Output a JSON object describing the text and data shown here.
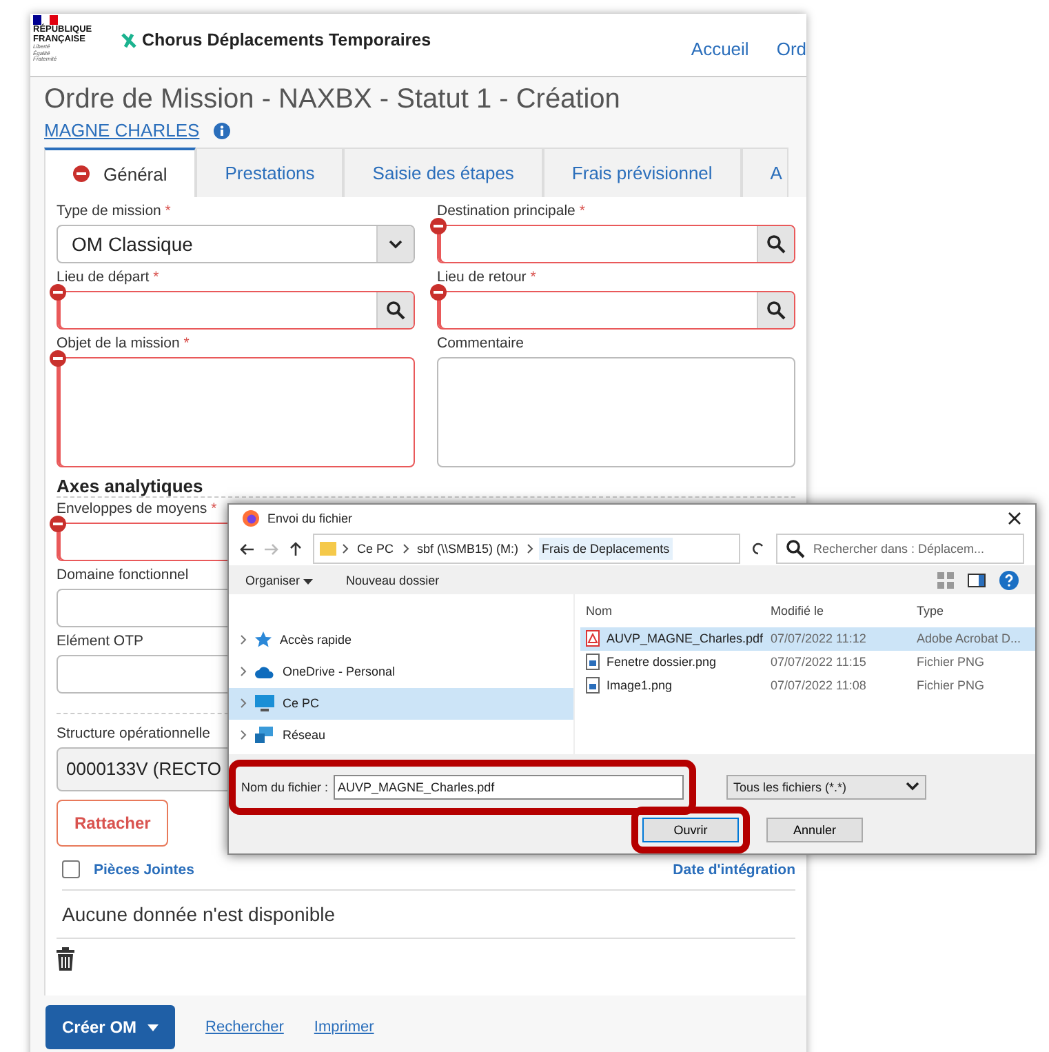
{
  "header": {
    "logo_lines": [
      "RÉPUBLIQUE",
      "FRANÇAISE"
    ],
    "motto": [
      "Liberté",
      "Égalité",
      "Fraternité"
    ],
    "app_name": "Chorus Déplacements Temporaires",
    "nav": [
      "Accueil",
      "Ord"
    ]
  },
  "page": {
    "title": "Ordre de Mission - NAXBX - Statut 1 - Création",
    "traveler": "MAGNE CHARLES"
  },
  "tabs": [
    {
      "label": "Général",
      "selected": true,
      "error": true
    },
    {
      "label": "Prestations",
      "selected": false,
      "error": false
    },
    {
      "label": "Saisie des étapes",
      "selected": false,
      "error": false
    },
    {
      "label": "Frais prévisionnel",
      "selected": false,
      "error": false
    },
    {
      "label": "A",
      "selected": false,
      "error": false
    }
  ],
  "form": {
    "fields": [
      {
        "label": "Type de mission",
        "required_mark": "*",
        "error": false,
        "kind": "select",
        "value": "OM Classique"
      },
      {
        "label": "Destination principale",
        "required_mark": "*",
        "error": true,
        "kind": "search"
      },
      {
        "label": "Lieu de départ",
        "required_mark": "*",
        "error": true,
        "kind": "search"
      },
      {
        "label": "Lieu de retour",
        "required_mark": "*",
        "error": true,
        "kind": "search"
      },
      {
        "label": "Objet de la mission",
        "required_mark": "*",
        "error": true,
        "kind": "textarea"
      },
      {
        "label": "Commentaire",
        "error": false,
        "kind": "textarea"
      }
    ]
  },
  "axes": {
    "heading": "Axes analytiques",
    "fields": [
      {
        "label": "Enveloppes de moyens",
        "required_mark": "*",
        "error": true,
        "kind": "text"
      },
      {
        "label": "Domaine fonctionnel",
        "error": false,
        "kind": "text"
      },
      {
        "label": "Elément OTP",
        "error": false,
        "kind": "text"
      }
    ]
  },
  "structure": {
    "label": "Structure opérationnelle",
    "value": "0000133V (RECTO"
  },
  "attach_button": "Rattacher",
  "attachments": {
    "column": "Pièces Jointes",
    "checked": false,
    "date_column": "Date d'intégration",
    "empty": "Aucune donnée n'est disponible"
  },
  "footer": {
    "create": "Créer OM",
    "links": [
      "Rechercher",
      "Imprimer"
    ]
  },
  "dialog": {
    "title": "Envoi du fichier",
    "path": [
      {
        "label": "Ce PC",
        "selected": false
      },
      {
        "label": "sbf (\\\\SMB15) (M:)",
        "selected": false
      },
      {
        "label": "Frais de Deplacements",
        "selected": true
      }
    ],
    "search_placeholder": "Rechercher dans : Déplacem...",
    "toolbar": [
      "Organiser",
      "Nouveau dossier"
    ],
    "tree": [
      {
        "label": "Accès rapide",
        "kind": "star",
        "selected": false
      },
      {
        "label": "OneDrive - Personal",
        "kind": "cloud",
        "selected": false
      },
      {
        "label": "Ce PC",
        "kind": "pc",
        "selected": true
      },
      {
        "label": "Réseau",
        "kind": "network",
        "selected": false
      }
    ],
    "columns": [
      "Nom",
      "Modifié le",
      "Type"
    ],
    "files": [
      {
        "name": "AUVP_MAGNE_Charles.pdf",
        "modified": "07/07/2022 11:12",
        "type": "Adobe Acrobat D...",
        "kind": "pdf",
        "selected": true
      },
      {
        "name": "Fenetre dossier.png",
        "modified": "07/07/2022 11:15",
        "type": "Fichier PNG",
        "kind": "png",
        "selected": false
      },
      {
        "name": "Image1.png",
        "modified": "07/07/2022 11:08",
        "type": "Fichier PNG",
        "kind": "png",
        "selected": false
      }
    ],
    "filename_label": "Nom du fichier :",
    "filename": "AUVP_MAGNE_Charles.pdf",
    "filter": "Tous les fichiers (*.*)",
    "buttons": [
      "Ouvrir",
      "Annuler"
    ]
  }
}
